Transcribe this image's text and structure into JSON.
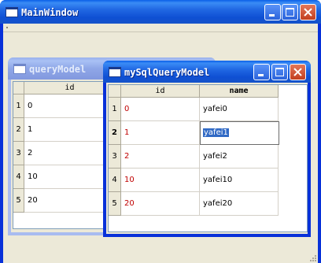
{
  "main_window": {
    "title": "MainWindow",
    "menu_marker": "."
  },
  "query_window": {
    "title": "queryModel",
    "columns": [
      "id"
    ],
    "rows": [
      {
        "header": "1",
        "id": "0"
      },
      {
        "header": "2",
        "id": "1"
      },
      {
        "header": "3",
        "id": "2"
      },
      {
        "header": "4",
        "id": "10"
      },
      {
        "header": "5",
        "id": "20"
      }
    ]
  },
  "mysql_window": {
    "title": "mySqlQueryModel",
    "columns": [
      "id",
      "name"
    ],
    "rows": [
      {
        "header": "1",
        "id": "0",
        "name": "yafei0"
      },
      {
        "header": "2",
        "id": "1",
        "name": "yafei1"
      },
      {
        "header": "3",
        "id": "2",
        "name": "yafei2"
      },
      {
        "header": "4",
        "id": "10",
        "name": "yafei10"
      },
      {
        "header": "5",
        "id": "20",
        "name": "yafei20"
      }
    ],
    "editing_value": "yafei1"
  },
  "colors": {
    "titlebar_active": "#0831d9",
    "titlebar_inactive": "#a9bcf0",
    "id_text": "#c00000",
    "selection": "#316ac5"
  },
  "icons": [
    "window-icon",
    "minimize-icon",
    "maximize-icon",
    "close-icon",
    "size-grip-icon"
  ]
}
